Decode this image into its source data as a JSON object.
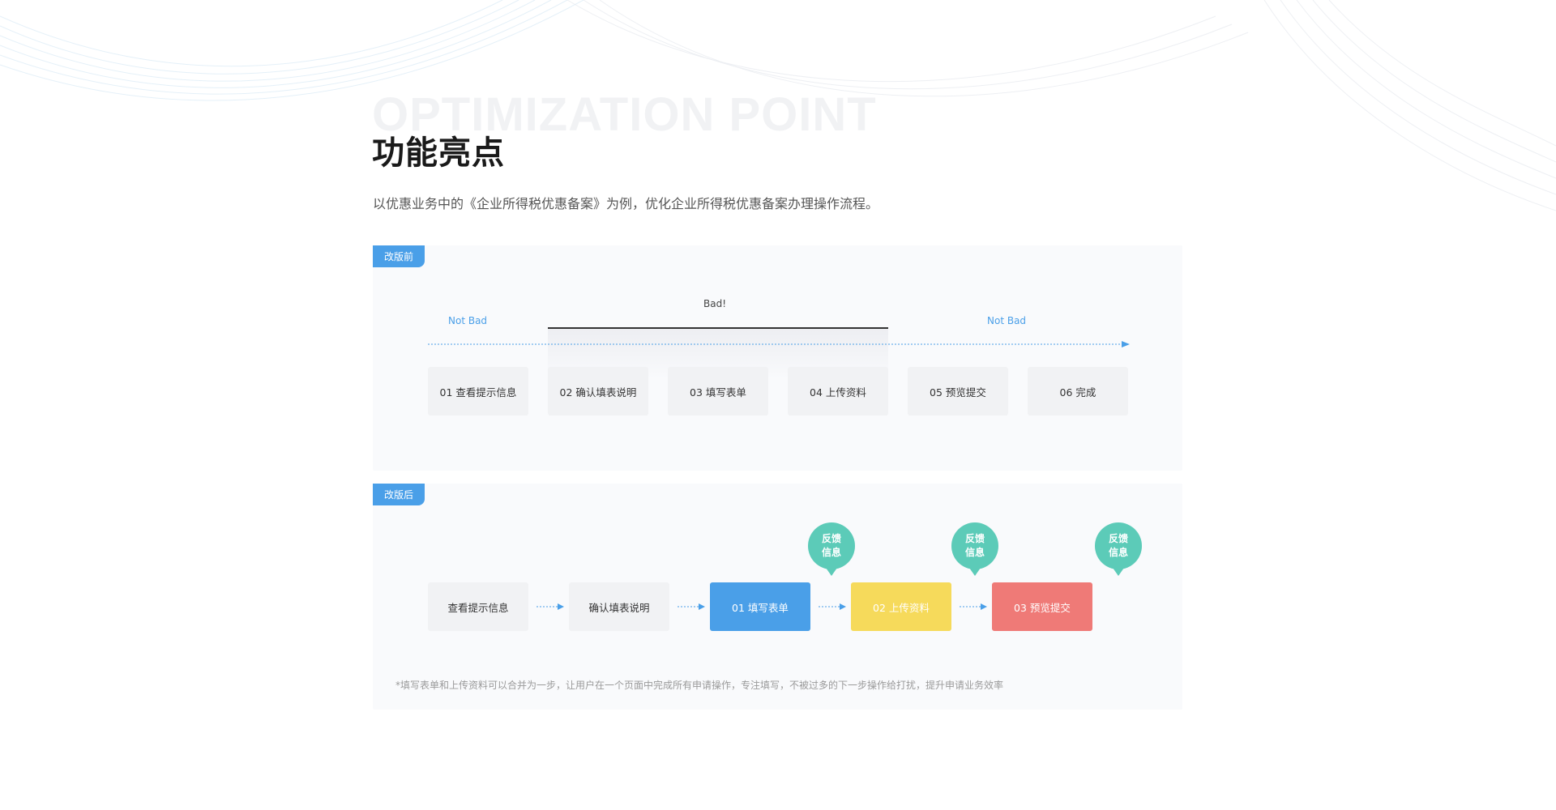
{
  "header": {
    "watermark": "OPTIMIZATION POINT",
    "title": "功能亮点",
    "subtitle": "以优惠业务中的《企业所得税优惠备案》为例，优化企业所得税优惠备案办理操作流程。"
  },
  "before": {
    "badge": "改版前",
    "label_left": "Not Bad",
    "label_middle": "Bad!",
    "label_right": "Not Bad",
    "steps": [
      "01 查看提示信息",
      "02 确认填表说明",
      "03 填写表单",
      "04 上传资料",
      "05 预览提交",
      "06 完成"
    ]
  },
  "after": {
    "badge": "改版后",
    "steps": [
      "查看提示信息",
      "确认填表说明",
      "01 填写表单",
      "02 上传资料",
      "03 预览提交"
    ],
    "bubbles": [
      {
        "line1": "反馈",
        "line2": "信息"
      },
      {
        "line1": "反馈",
        "line2": "信息"
      },
      {
        "line1": "反馈",
        "line2": "信息"
      }
    ],
    "note": "*填写表单和上传资料可以合并为一步，让用户在一个页面中完成所有申请操作，专注填写，不被过多的下一步操作给打扰，提升申请业务效率"
  },
  "colors": {
    "accent_blue": "#4a9fe8",
    "teal": "#5ccbb8",
    "yellow": "#f6da5b",
    "red": "#ef7a77",
    "gray_box": "#f1f2f4"
  },
  "icons": {
    "timeline_arrow": "dotted-arrow-right",
    "flow_arrow": "dotted-arrow-right",
    "bubble": "speech-bubble"
  }
}
